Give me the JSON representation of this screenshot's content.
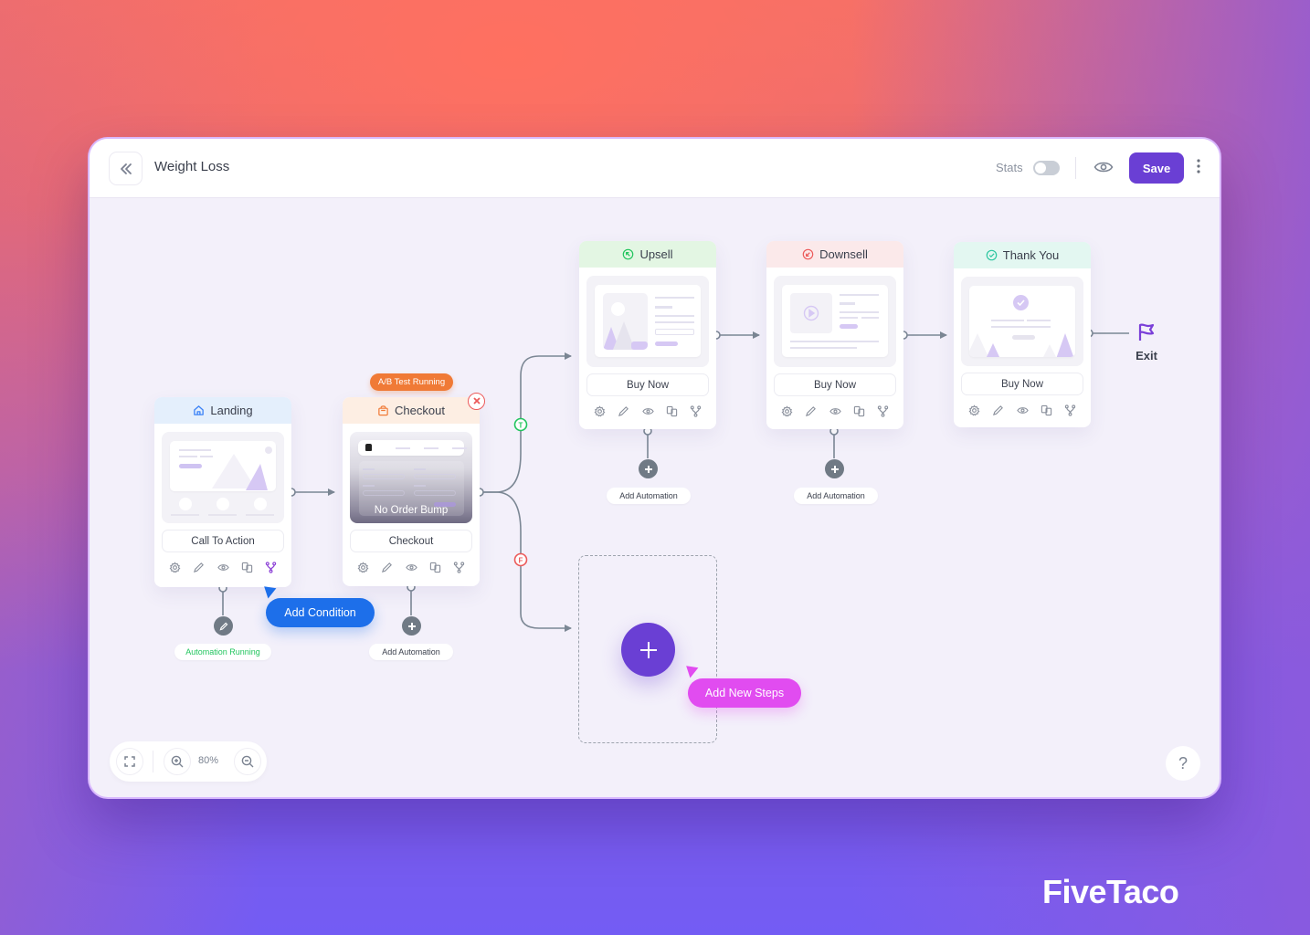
{
  "header": {
    "title": "Weight Loss",
    "back_icon": "double-chevron-left-icon",
    "stats_label": "Stats",
    "stats_enabled": false,
    "preview_icon": "eye-icon",
    "save_label": "Save",
    "more_icon": "vertical-dots-icon"
  },
  "colors": {
    "accent": "#6a3fd4",
    "add_condition": "#1d6fea",
    "add_steps": "#e14cf0",
    "ab_badge": "#f07a36",
    "true_branch": "#22c55e",
    "false_branch": "#ec5a5a",
    "automation_running": "#22c55e"
  },
  "nodes": [
    {
      "id": "landing",
      "title": "Landing",
      "icon": "home-icon",
      "header_color": "#e4effc",
      "button": "Call To Action",
      "automation": "Automation Running",
      "automation_icon": "pencil-icon"
    },
    {
      "id": "checkout",
      "title": "Checkout",
      "icon": "shopping-bag-icon",
      "header_color": "#fdeee3",
      "button": "Checkout",
      "overlay": "No Order Bump",
      "badge": "A/B Test Running",
      "automation": "Add Automation",
      "automation_icon": "plus-icon"
    },
    {
      "id": "upsell",
      "title": "Upsell",
      "icon": "arrow-up-left-circle-icon",
      "header_color": "#e3f6e3",
      "button": "Buy Now",
      "automation": "Add Automation",
      "automation_icon": "plus-icon"
    },
    {
      "id": "downsell",
      "title": "Downsell",
      "icon": "arrow-down-left-circle-icon",
      "header_color": "#fbe9ea",
      "button": "Buy Now",
      "automation": "Add Automation",
      "automation_icon": "plus-icon"
    },
    {
      "id": "thankyou",
      "title": "Thank You",
      "icon": "check-circle-icon",
      "header_color": "#e3f7f1",
      "button": "Buy Now"
    }
  ],
  "tools": [
    "gear-icon",
    "pencil-icon",
    "eye-icon",
    "duplicate-icon",
    "split-icon"
  ],
  "branches": {
    "true_label": "T",
    "false_label": "F"
  },
  "exit_label": "Exit",
  "add_condition_label": "Add Condition",
  "add_steps_label": "Add New Steps",
  "zoom": {
    "value": "80%",
    "fit_icon": "fullscreen-icon",
    "zoom_in_icon": "zoom-in-icon",
    "zoom_out_icon": "zoom-out-icon"
  },
  "help_label": "?",
  "brand": "FiveTaco"
}
